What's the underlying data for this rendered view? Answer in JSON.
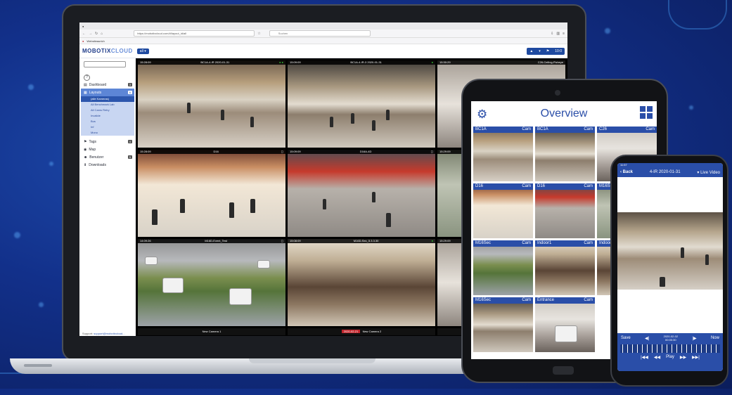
{
  "browser": {
    "url": "https://mobotixcloud.com/#/layout_id/all",
    "search_placeholder": "Suchen",
    "bookmark": "Websiteaurich"
  },
  "app": {
    "logo_main": "MOBOTIX",
    "logo_suffix": "CLOUD",
    "scope_button": "all",
    "header_time": "10:0"
  },
  "sidebar": {
    "items": [
      {
        "label": "Dashboard",
        "count": "3"
      },
      {
        "label": "Layouts",
        "count": "6"
      },
      {
        "label": "Tags",
        "count": "4"
      },
      {
        "label": "Map",
        "count": ""
      },
      {
        "label": "Benutzer",
        "count": "5"
      },
      {
        "label": "Downloads",
        "count": ""
      }
    ],
    "layouts_sub": [
      "(alle Kameras)",
      "All Benchmark Lab",
      "All Cams Retry",
      "Invalide",
      "Bus",
      "Inf",
      "Mono"
    ],
    "support_label": "Support:",
    "support_email": "support@mobotixcloud..."
  },
  "cameras": [
    {
      "time": "15:28:09",
      "name": "BC1A-4-IR 2020-01-31"
    },
    {
      "time": "15:09:09",
      "name": "BC1A-4-IR-3 2020-01-31"
    },
    {
      "time": "15:30:29",
      "name": "C26-Ceiling-Fisheye"
    },
    {
      "time": "15:28:09",
      "name": "D16"
    },
    {
      "time": "15:09:09",
      "name": "D16A-4D"
    },
    {
      "time": "15:29:09",
      "name": ""
    },
    {
      "time": "14:09:26",
      "name": "M16D-Event_Test"
    },
    {
      "time": "15:08:09",
      "name": "M16D-Sec_5.3.3.30"
    },
    {
      "time": "15:29:09",
      "name": ""
    }
  ],
  "bottom_labels": [
    "New Camera 1",
    "2020-02-21",
    "New Camera 2"
  ],
  "tablet": {
    "title": "Overview",
    "tiles": [
      {
        "name": "BC1A",
        "tag": "Cam"
      },
      {
        "name": "BC1A",
        "tag": "Cam"
      },
      {
        "name": "C26",
        "tag": "Cam"
      },
      {
        "name": "D16",
        "tag": "Cam"
      },
      {
        "name": "D16",
        "tag": "Cam"
      },
      {
        "name": "M16Sec",
        "tag": ""
      },
      {
        "name": "M16Sec",
        "tag": "Cam"
      },
      {
        "name": "Indoor1",
        "tag": "Cam"
      },
      {
        "name": "Indoor",
        "tag": ""
      },
      {
        "name": "M16Sec",
        "tag": "Cam"
      },
      {
        "name": "Entrance",
        "tag": "Cam"
      },
      {
        "name": "",
        "tag": ""
      }
    ]
  },
  "phone": {
    "status_time": "11:57",
    "back": "Back",
    "title": "4-IR 2020-01-31",
    "mode": "Live Video",
    "save": "Save",
    "date": "2020-02-02",
    "time": "00:00:30",
    "now": "Now",
    "play": "Play"
  }
}
